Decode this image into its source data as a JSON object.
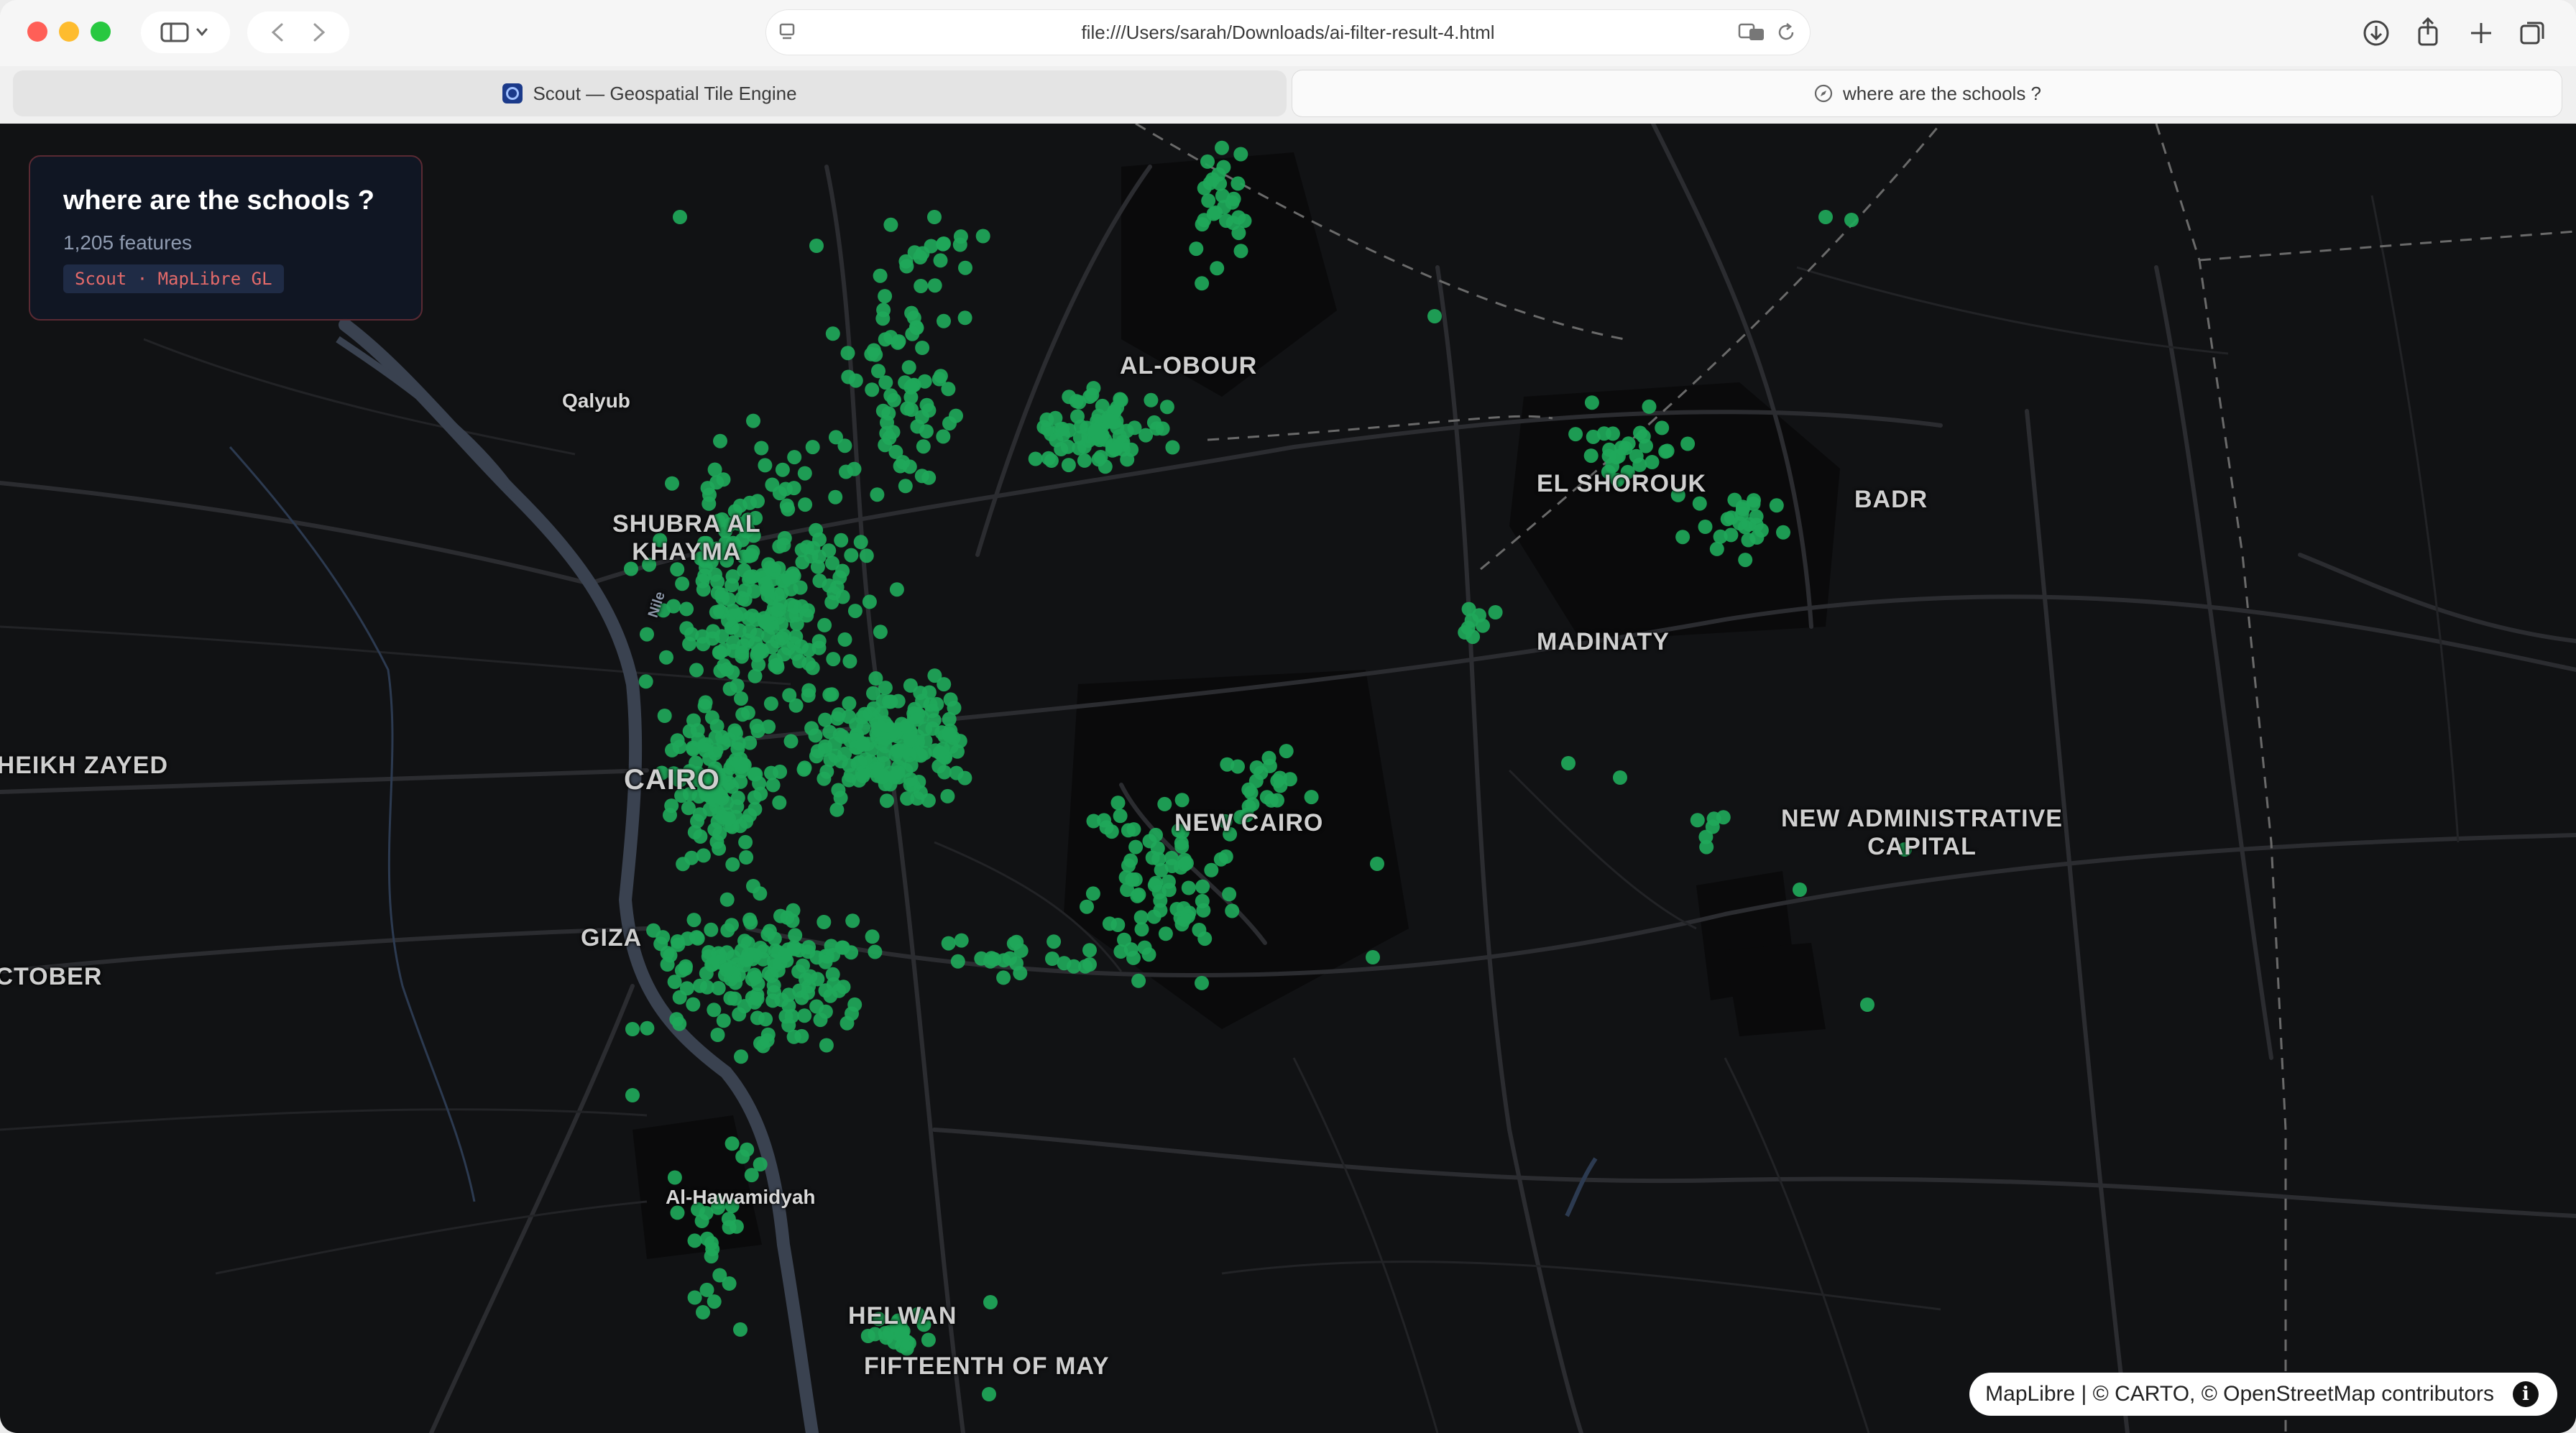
{
  "browser": {
    "url": "file:///Users/sarah/Downloads/ai-filter-result-4.html",
    "tabs": [
      {
        "label": "Scout — Geospatial Tile Engine",
        "active": false
      },
      {
        "label": "where are the schools ?",
        "active": true
      }
    ]
  },
  "panel": {
    "title": "where are the schools ?",
    "count": "1,205 features",
    "badge": "Scout · MapLibre GL"
  },
  "map": {
    "point_color": "#1fa85a",
    "background": "#111214",
    "labels": {
      "qalyub": "Qalyub",
      "al_obour": "AL-OBOUR",
      "el_shorouk": "EL SHOROUK",
      "badr": "BADR",
      "shubra_1": "SHUBRA AL",
      "shubra_2": "KHAYMA",
      "madinaty": "MADINATY",
      "sheikh_zayed": "SHEIKH ZAYED",
      "cairo": "CAIRO",
      "new_cairo": "NEW CAIRO",
      "nac_1": "NEW ADMINISTRATIVE",
      "nac_2": "CAPITAL",
      "giza": "GIZA",
      "october": "OCTOBER",
      "hawamdiyah": "Al-Hawamidyah",
      "helwan": "HELWAN",
      "fifteenth_may": "FIFTEENTH OF MAY",
      "nile": "Nile"
    }
  },
  "attribution": {
    "text": "MapLibre | © CARTO, © OpenStreetMap contributors"
  }
}
